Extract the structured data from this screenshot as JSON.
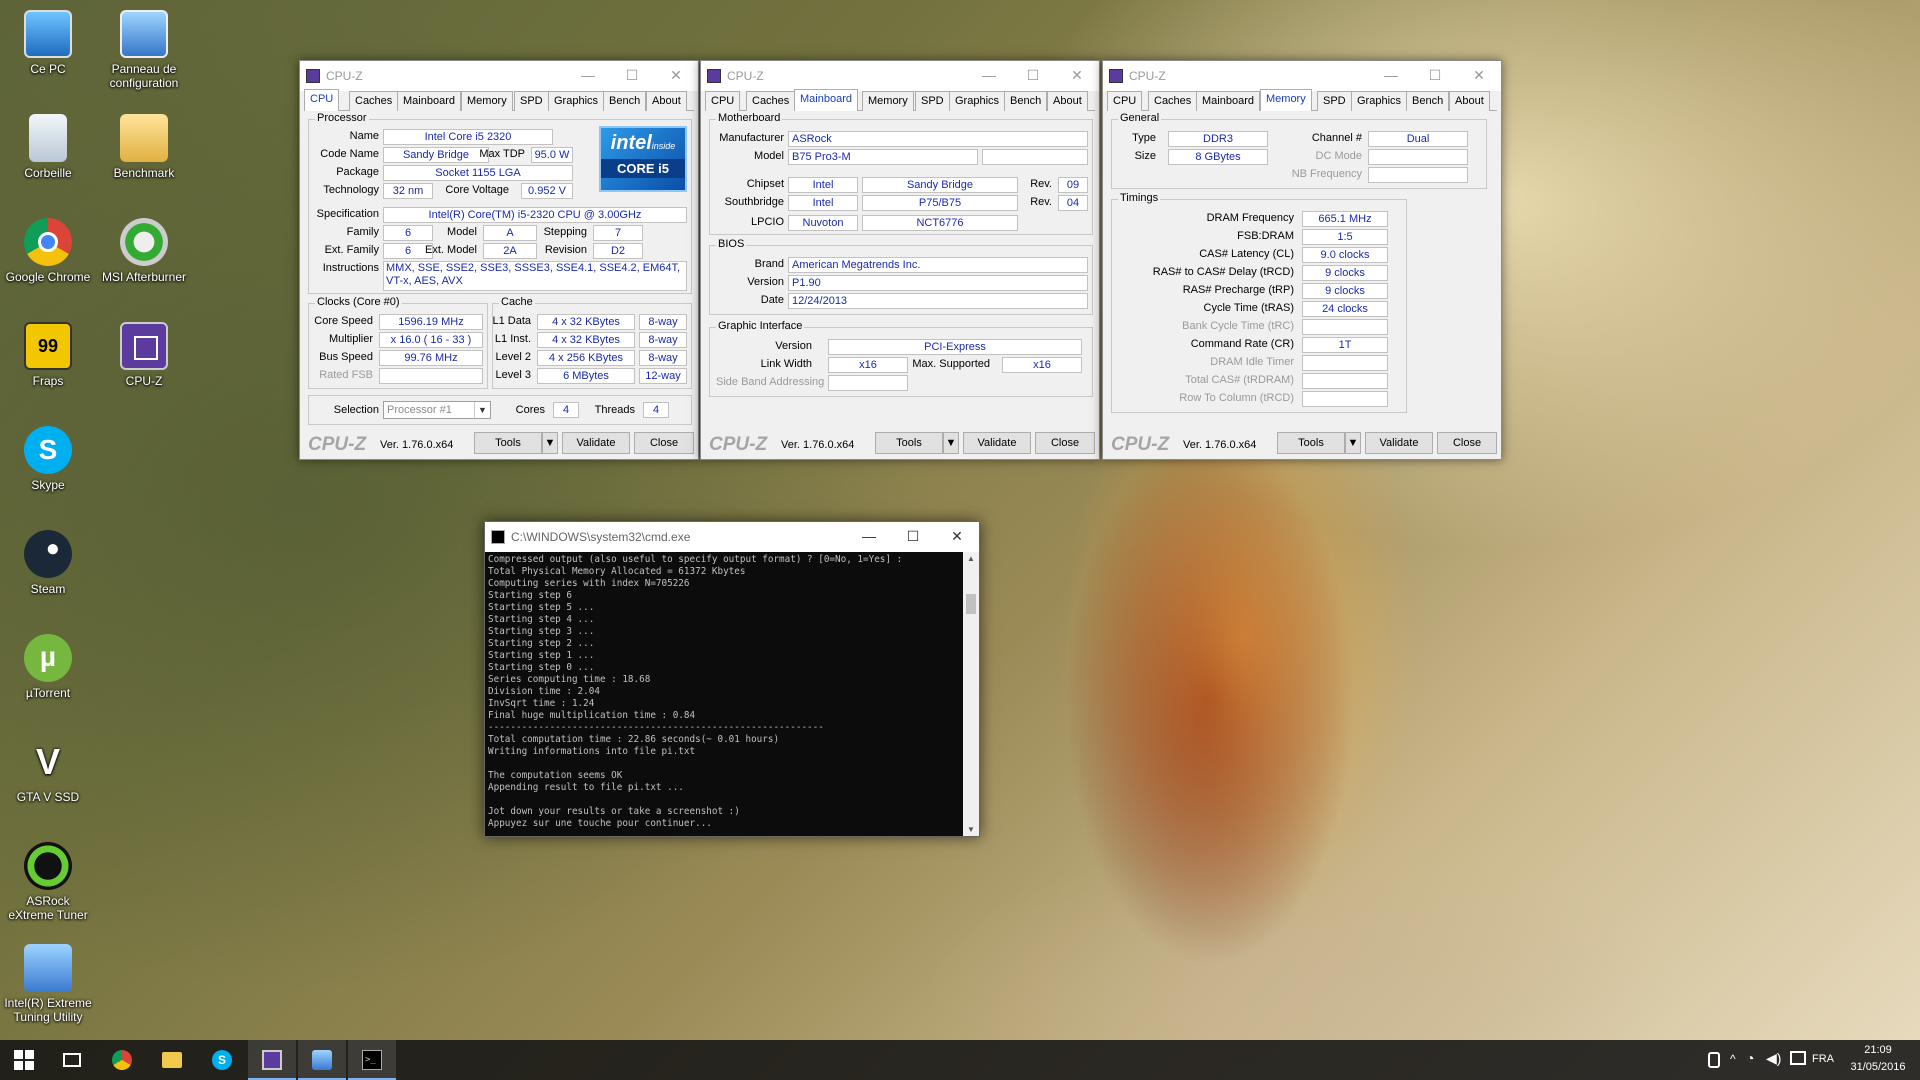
{
  "desktop": {
    "icons": [
      {
        "label": "Ce PC"
      },
      {
        "label": "Panneau de configuration"
      },
      {
        "label": "Corbeille"
      },
      {
        "label": "Benchmark"
      },
      {
        "label": "Google Chrome"
      },
      {
        "label": "MSI Afterburner"
      },
      {
        "label": "Fraps"
      },
      {
        "label": "CPU-Z"
      },
      {
        "label": "Skype"
      },
      {
        "label": "Steam"
      },
      {
        "label": "µTorrent"
      },
      {
        "label": "GTA V SSD"
      },
      {
        "label": "ASRock eXtreme Tuner"
      },
      {
        "label": "Intel(R) Extreme Tuning Utility"
      }
    ]
  },
  "cpuz_common": {
    "title": "CPU-Z",
    "tabs": [
      "CPU",
      "Caches",
      "Mainboard",
      "Memory",
      "SPD",
      "Graphics",
      "Bench",
      "About"
    ],
    "logo": "CPU-Z",
    "version": "Ver. 1.76.0.x64",
    "tools_label": "Tools",
    "validate_label": "Validate",
    "close_label": "Close"
  },
  "cpu_tab": {
    "processor_group": "Processor",
    "name_label": "Name",
    "name": "Intel Core i5 2320",
    "codename_label": "Code Name",
    "codename": "Sandy Bridge",
    "maxtdp_label": "Max TDP",
    "maxtdp": "95.0 W",
    "package_label": "Package",
    "package": "Socket 1155 LGA",
    "technology_label": "Technology",
    "technology": "32 nm",
    "corevoltage_label": "Core Voltage",
    "corevoltage": "0.952 V",
    "spec_label": "Specification",
    "spec": "Intel(R) Core(TM) i5-2320 CPU @ 3.00GHz",
    "family_label": "Family",
    "family": "6",
    "model_label": "Model",
    "model": "A",
    "stepping_label": "Stepping",
    "stepping": "7",
    "extfamily_label": "Ext. Family",
    "extfamily": "6",
    "extmodel_label": "Ext. Model",
    "extmodel": "2A",
    "revision_label": "Revision",
    "revision": "D2",
    "instructions_label": "Instructions",
    "instructions": "MMX, SSE, SSE2, SSE3, SSSE3, SSE4.1, SSE4.2, EM64T, VT-x, AES, AVX",
    "intel_logo_top": "intel",
    "intel_logo_inside": "inside",
    "intel_logo_bottom": "CORE i5",
    "clocks_group": "Clocks (Core #0)",
    "corespeed_label": "Core Speed",
    "corespeed": "1596.19 MHz",
    "multiplier_label": "Multiplier",
    "multiplier": "x 16.0 ( 16 - 33 )",
    "busspeed_label": "Bus Speed",
    "busspeed": "99.76 MHz",
    "ratedfsb_label": "Rated FSB",
    "cache_group": "Cache",
    "l1data_label": "L1 Data",
    "l1data": "4 x 32 KBytes",
    "l1data_way": "8-way",
    "l1inst_label": "L1 Inst.",
    "l1inst": "4 x 32 KBytes",
    "l1inst_way": "8-way",
    "l2_label": "Level 2",
    "l2": "4 x 256 KBytes",
    "l2_way": "8-way",
    "l3_label": "Level 3",
    "l3": "6 MBytes",
    "l3_way": "12-way",
    "selection_label": "Selection",
    "selection": "Processor #1",
    "cores_label": "Cores",
    "cores": "4",
    "threads_label": "Threads",
    "threads": "4"
  },
  "mainboard_tab": {
    "mb_group": "Motherboard",
    "manufacturer_label": "Manufacturer",
    "manufacturer": "ASRock",
    "model_label": "Model",
    "model": "B75 Pro3-M",
    "chipset_label": "Chipset",
    "chipset_vendor": "Intel",
    "chipset": "Sandy Bridge",
    "chipset_rev_label": "Rev.",
    "chipset_rev": "09",
    "southbridge_label": "Southbridge",
    "sb_vendor": "Intel",
    "sb": "P75/B75",
    "sb_rev_label": "Rev.",
    "sb_rev": "04",
    "lpcio_label": "LPCIO",
    "lpcio_vendor": "Nuvoton",
    "lpcio": "NCT6776",
    "bios_group": "BIOS",
    "brand_label": "Brand",
    "brand": "American Megatrends Inc.",
    "version_label": "Version",
    "version": "P1.90",
    "date_label": "Date",
    "date": "12/24/2013",
    "gi_group": "Graphic Interface",
    "gi_version_label": "Version",
    "gi_version": "PCI-Express",
    "linkwidth_label": "Link Width",
    "linkwidth": "x16",
    "maxsupported_label": "Max. Supported",
    "maxsupported": "x16",
    "sideband_label": "Side Band Addressing"
  },
  "memory_tab": {
    "general_group": "General",
    "type_label": "Type",
    "type": "DDR3",
    "size_label": "Size",
    "size": "8 GBytes",
    "channel_label": "Channel #",
    "channel": "Dual",
    "dcmode_label": "DC Mode",
    "nbfreq_label": "NB Frequency",
    "timings_group": "Timings",
    "dramfreq_label": "DRAM Frequency",
    "dramfreq": "665.1 MHz",
    "fsbdram_label": "FSB:DRAM",
    "fsbdram": "1:5",
    "cl_label": "CAS# Latency (CL)",
    "cl": "9.0 clocks",
    "trcd_label": "RAS# to CAS# Delay (tRCD)",
    "trcd": "9 clocks",
    "trp_label": "RAS# Precharge (tRP)",
    "trp": "9 clocks",
    "tras_label": "Cycle Time (tRAS)",
    "tras": "24 clocks",
    "trc_label": "Bank Cycle Time (tRC)",
    "cr_label": "Command Rate (CR)",
    "cr": "1T",
    "idle_label": "DRAM Idle Timer",
    "trdram_label": "Total CAS# (tRDRAM)",
    "rtc_label": "Row To Column (tRCD)"
  },
  "cmd": {
    "title": "C:\\WINDOWS\\system32\\cmd.exe",
    "output": "Compressed output (also useful to specify output format) ? [0=No, 1=Yes] :\nTotal Physical Memory Allocated = 61372 Kbytes\nComputing series with index N=705226\nStarting step 6\nStarting step 5 ...\nStarting step 4 ...\nStarting step 3 ...\nStarting step 2 ...\nStarting step 1 ...\nStarting step 0 ...\nSeries computing time : 18.68\nDivision time : 2.04\nInvSqrt time : 1.24\nFinal huge multiplication time : 0.84\n------------------------------------------------------------\nTotal computation time : 22.86 seconds(~ 0.01 hours)\nWriting informations into file pi.txt\n\nThe computation seems OK\nAppending result to file pi.txt ...\n\nJot down your results or take a screenshot :)\nAppuyez sur une touche pour continuer..."
  },
  "taskbar": {
    "language": "FRA",
    "time": "21:09",
    "date": "31/05/2016"
  }
}
